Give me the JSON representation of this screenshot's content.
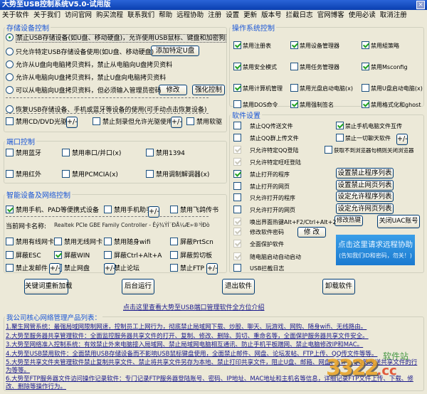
{
  "window": {
    "title": "大势至USB控制系统V5.0-试用版",
    "close": "×"
  },
  "menu": [
    "关于软件",
    "关于我们",
    "访问官网",
    "购买流程",
    "联系我们",
    "帮助",
    "远程协助",
    "注册",
    "设置",
    "更新",
    "版本号",
    "拦截日志",
    "官网博客",
    "使用必读",
    "取消注册"
  ],
  "storage": {
    "title": "存储设备控制",
    "radios": [
      {
        "label": "禁止USB存储设备(如U盘、移动硬盘)，允许使用USB鼠标、键盘和加密狗",
        "checked": true
      },
      {
        "label": "只允许特定USB存储设备使用(如U盘、移动硬盘)",
        "checked": false
      },
      {
        "label": "允许从U盘向电脑拷贝资料，禁止从电脑向U盘拷贝资料",
        "checked": false
      },
      {
        "label": "允许从电脑向U盘拷贝资料，禁止U盘向电脑拷贝资料",
        "checked": false
      },
      {
        "label": "可以从电脑向U盘拷贝资料，但必须输入管理员密码",
        "checked": false
      },
      {
        "label": "恢复USB存储设备、手机或蓝牙等设备的使用(可手动点击恢复设备)",
        "checked": false
      }
    ],
    "add_usb": "添加特定U盘",
    "modify": "修改",
    "enhance": "强化控制",
    "checks": [
      {
        "label": "禁用CD/DVD光驱",
        "checked": false
      },
      {
        "label": "禁止刻录但允许光驱使用",
        "checked": false
      },
      {
        "label": "禁用软驱",
        "checked": false
      }
    ],
    "plusminus": "+/-"
  },
  "port": {
    "title": "端口控制",
    "checks": [
      {
        "label": "禁用蓝牙",
        "checked": false
      },
      {
        "label": "禁用串口/并口(x)",
        "checked": false
      },
      {
        "label": "禁用1394",
        "checked": false
      },
      {
        "label": "禁用红外",
        "checked": false
      },
      {
        "label": "禁用PCMCIA(x)",
        "checked": false
      },
      {
        "label": "禁用调制解调器(x)",
        "checked": false
      }
    ]
  },
  "smart": {
    "title": "智能设备及网络控制",
    "row1": [
      {
        "label": "禁用手机、PAD等便携式设备",
        "checked": true
      },
      {
        "label": "禁用手机助手",
        "checked": false
      },
      {
        "label": "禁用飞鸽传书",
        "checked": false
      }
    ],
    "nic_label": "当前网卡名称:",
    "nic_value": "Realtek PCIe GBE Family Controller - Êý¾ÝÍ¨ÐÅ¼Æ»®³ÌÐò",
    "row2": [
      {
        "label": "禁用有线网卡",
        "checked": false
      },
      {
        "label": "禁用无线网卡",
        "checked": false
      },
      {
        "label": "禁用随身wifi",
        "checked": false
      },
      {
        "label": "屏蔽PrtScn",
        "checked": false
      }
    ],
    "row3": [
      {
        "label": "屏蔽ESC",
        "checked": false
      },
      {
        "label": "屏蔽WIN",
        "checked": true
      },
      {
        "label": "屏蔽Ctrl+Alt+A",
        "checked": false
      },
      {
        "label": "屏蔽剪切板",
        "checked": false
      }
    ],
    "row4": [
      {
        "label": "禁止发邮件",
        "checked": false
      },
      {
        "label": "禁止网盘",
        "checked": false
      },
      {
        "label": "禁止论坛",
        "checked": false
      },
      {
        "label": "禁止FTP",
        "checked": false
      }
    ]
  },
  "os": {
    "title": "操作系统控制",
    "checks": [
      {
        "label": "禁用注册表",
        "checked": true
      },
      {
        "label": "禁用设备管理器",
        "checked": true
      },
      {
        "label": "禁用組策略",
        "checked": true
      },
      {
        "label": "禁用安全模式",
        "checked": true
      },
      {
        "label": "禁用任务管理器",
        "checked": false
      },
      {
        "label": "禁用Msconfig",
        "checked": true
      },
      {
        "label": "禁用计算机管理",
        "checked": true
      },
      {
        "label": "禁用光盘启动电脑(x)",
        "checked": false
      },
      {
        "label": "禁用U盘启动电脑(x)",
        "checked": false
      },
      {
        "label": "禁用DOS命令",
        "checked": false
      },
      {
        "label": "禁用强制签名",
        "checked": true
      },
      {
        "label": "禁用格式化和ghost",
        "checked": true
      }
    ]
  },
  "software": {
    "title": "软件设置",
    "left": [
      {
        "label": "禁止QQ传送文件",
        "checked": false,
        "disabled": false
      },
      {
        "label": "禁止QQ群上传文件",
        "checked": false,
        "disabled": false
      },
      {
        "label": "只允许特定QQ登陆",
        "checked": true,
        "disabled": true
      },
      {
        "label": "只允许特定旺旺登陆",
        "checked": true,
        "disabled": true
      },
      {
        "label": "禁止打开的程序",
        "checked": true,
        "disabled": false
      },
      {
        "label": "禁止打开的网页",
        "checked": false,
        "disabled": false
      },
      {
        "label": "只允许打开的程序",
        "checked": false,
        "disabled": false
      },
      {
        "label": "只允许打开的网页",
        "checked": false,
        "disabled": false
      },
      {
        "label": "唤出界面热键Alt+F2/Ctrl+Alt+2",
        "checked": true,
        "disabled": true
      },
      {
        "label": "修改软件密码",
        "checked": true,
        "disabled": true
      },
      {
        "label": "全面保护软件",
        "checked": true,
        "disabled": true
      },
      {
        "label": "随电脑启动自动启动",
        "checked": true,
        "disabled": true
      },
      {
        "label": "USB拦截日志",
        "checked": false,
        "disabled": false
      }
    ],
    "right": [
      {
        "label": "禁止手机电脑文件互传",
        "checked": true
      },
      {
        "label": "禁止一切聊天软件",
        "checked": false
      },
      {
        "label": "获取不到浏览器句柄则关闭浏览器",
        "checked": false
      }
    ],
    "buttons": [
      "设置禁止程序列表",
      "设置禁止网页列表",
      "设定允许程序列表",
      "设定允许网页列表"
    ],
    "hotkey_btn": "修改热键",
    "uac_btn": "关闭UAC账号",
    "modify_btn": "修 改",
    "remote_line1": "点击这里请求远程协助",
    "remote_line2": "(告知我们ID和密码，勿关！)"
  },
  "actions": [
    "关键词重新加载",
    "后台运行",
    "退出软件",
    "卸载软件"
  ],
  "intro_link": "点击这里查看大势至USB端口管理软件全方位介绍",
  "products": {
    "title": "我公司核心网络管理产品列表：",
    "items": [
      "1.聚生网管系统：最强局域网限制网速，控制员工上网行为，彻底禁止局域网下载、炒股、聊天、玩游戏、网购、随身wifi、无线路由。",
      "2.大势至服务器共享管理软件：全面监控服务器共享文件的打开、复制、修改、删除、剪切、重命名等，全面保护服务器共享文件安全。",
      "3.大势至网络准入控制系统：有效禁止外来电脑接入局域网、禁止局域网电脑相互通讯、防止手机平板蹭网、禁止电脑修改IP和MAC。",
      "4.大势至USB禁用软件：全面禁用USB存储设备而不影响USB鼠标键盘使用，全面禁止邮件、网盘、论坛发帖、FTP上传、QQ传文件等等。",
      "5.大势至共享文件夹管理软件禁止复制共享文件、禁止将共享文件另存为本地、禁止打印共享文件，阻止U盘、邮箱、网盘、FTP、QQ等发送共享文件的行为等等。",
      "6.大势至FTP服务器文件访问操作记录软件：专门记录FTP服务器登陆账号、密码、IP地址、MAC地址和主机名等信息，详细记录FTP文件上传、下载、修改、删除等操作行为。"
    ]
  },
  "watermark": {
    "text": "3322",
    "suffix": ".cc",
    "site": "软件站"
  }
}
